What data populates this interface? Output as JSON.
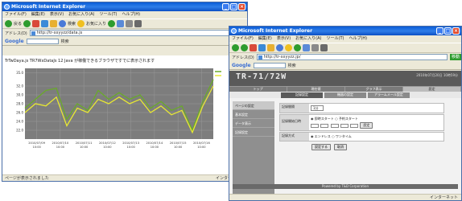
{
  "window1": {
    "title": "Microsoft Internet Explorer",
    "menu": [
      "ファイル(F)",
      "編集(E)",
      "表示(V)",
      "お気に入り(A)",
      "ツール(T)",
      "ヘルプ(H)"
    ],
    "toolbar": {
      "back_label": "戻る",
      "search_label": "検索",
      "favorites_label": "お気に入り"
    },
    "address": {
      "label": "アドレス(D)",
      "url": "http://tr-xxyyzz/data.js",
      "go_label": "移動"
    },
    "google": {
      "label": "Google",
      "search_label": "検索"
    },
    "page_text": "TrTwDaya.js TR7WxDataJs 12 Java が稼働できるブラウザですでに表示されます",
    "status": {
      "left": "ページが表示されました",
      "zone": "インターネット"
    }
  },
  "window2": {
    "title": "Microsoft Internet Explorer",
    "menu": [
      "ファイル(F)",
      "編集(E)",
      "表示(V)",
      "お気に入り(A)",
      "ツール(T)",
      "ヘルプ(H)"
    ],
    "address": {
      "label": "アドレス(D)",
      "url": "http://tr-xxyyzz.jp/",
      "go_label": "移動"
    },
    "google": {
      "label": "Google",
      "search_label": "検索"
    },
    "app_title": "TR-71/72W",
    "header_info": "2010年07月20日 10時59分",
    "nav": [
      "トップ",
      "現在値",
      "グラフ表示",
      "設定"
    ],
    "subtabs": [
      "記録設定",
      "機器の設定",
      "アラームメール設定"
    ],
    "sidebar": [
      "ページの設定",
      "基本設定",
      "データ表示",
      "記録設定"
    ],
    "form": {
      "row1_label": "記録間隔",
      "row1_value": "1分",
      "row2_label": "記録開始日時",
      "row2_opt1": "即時スタート",
      "row2_opt2": "予約スタート",
      "row2_set": "設定",
      "row3_label": "記録方式",
      "row3_opt1": "エンドレス",
      "row3_opt2": "ワンタイム",
      "submit": "設定する",
      "reset": "取消"
    },
    "footer": "Powered by T&D Corporation",
    "status": {
      "left": "",
      "zone": "インターネット"
    }
  },
  "chart_data": {
    "type": "line",
    "ylim": [
      20,
      36
    ],
    "yticks": [
      "35.0",
      "32.0",
      "30.0",
      "28.0",
      "26.0",
      "24.0",
      "22.0"
    ],
    "categories": [
      "2010/07/09 10:00",
      "2010/07/10 10:00",
      "2010/07/11 10:00",
      "2010/07/12 10:00",
      "2010/07/13 10:00",
      "2010/07/14 10:00",
      "2010/07/15 10:00",
      "2010/07/16 10:00"
    ],
    "series": [
      {
        "values": [
          27,
          29,
          31,
          31.5,
          24.5,
          28,
          26.5,
          31,
          29,
          30.5,
          29,
          30,
          27,
          28.5,
          26.5,
          27.5,
          22,
          28.5,
          33.5
        ],
        "color": "#6aaa2a"
      },
      {
        "values": [
          26,
          28,
          27.5,
          29.5,
          23,
          27,
          26,
          29,
          28,
          29.5,
          28,
          29,
          26,
          27.5,
          25.5,
          26.5,
          21.5,
          27.5,
          32
        ],
        "color": "#e8e832"
      }
    ],
    "legend": [
      "",
      ""
    ]
  }
}
